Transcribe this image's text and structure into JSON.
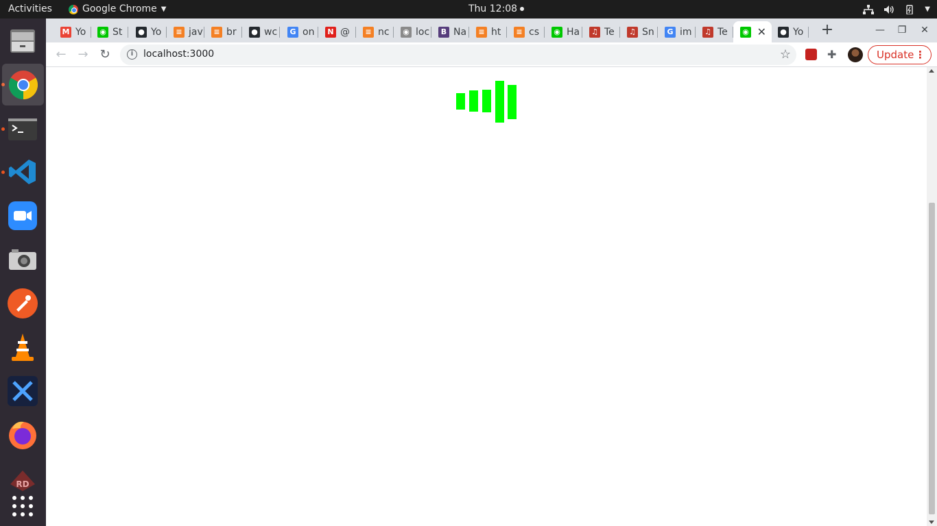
{
  "topbar": {
    "activities": "Activities",
    "app_name": "Google Chrome",
    "clock": "Thu 12:08"
  },
  "dock": {
    "items": [
      {
        "name": "files",
        "running": false
      },
      {
        "name": "google-chrome",
        "running": true,
        "active": true
      },
      {
        "name": "terminal",
        "running": true
      },
      {
        "name": "vscode",
        "running": true
      },
      {
        "name": "zoom",
        "running": false
      },
      {
        "name": "camera",
        "running": false
      },
      {
        "name": "postman",
        "running": false
      },
      {
        "name": "vlc",
        "running": false
      },
      {
        "name": "expressvpn",
        "running": false
      },
      {
        "name": "firefox",
        "running": false
      },
      {
        "name": "rd",
        "running": false
      },
      {
        "name": "show-applications",
        "running": false
      }
    ]
  },
  "tabs": [
    {
      "label": "Yo",
      "icon": "gmail-icon",
      "color": "#ea4335",
      "glyph": "M"
    },
    {
      "label": "St",
      "icon": "green-app-icon",
      "color": "#00c800",
      "glyph": "◉"
    },
    {
      "label": "Yo",
      "icon": "github-icon",
      "color": "#24292e",
      "glyph": "●"
    },
    {
      "label": "jav",
      "icon": "stackoverflow-icon",
      "color": "#f48024",
      "glyph": "≡"
    },
    {
      "label": "br",
      "icon": "stackoverflow-icon",
      "color": "#f48024",
      "glyph": "≡"
    },
    {
      "label": "wc",
      "icon": "github-icon",
      "color": "#24292e",
      "glyph": "●"
    },
    {
      "label": "on",
      "icon": "google-icon",
      "color": "#4285f4",
      "glyph": "G"
    },
    {
      "label": "@",
      "icon": "red-app-icon",
      "color": "#e0201b",
      "glyph": "N"
    },
    {
      "label": "nc",
      "icon": "stackoverflow-icon",
      "color": "#f48024",
      "glyph": "≡"
    },
    {
      "label": "loc",
      "icon": "gray-app-icon",
      "color": "#8a8a8a",
      "glyph": "◉"
    },
    {
      "label": "Na",
      "icon": "bootstrap-icon",
      "color": "#563d7c",
      "glyph": "B"
    },
    {
      "label": "ht",
      "icon": "stackoverflow-icon",
      "color": "#f48024",
      "glyph": "≡"
    },
    {
      "label": "cs",
      "icon": "stackoverflow-icon",
      "color": "#f48024",
      "glyph": "≡"
    },
    {
      "label": "Ha",
      "icon": "green-app-icon",
      "color": "#00c800",
      "glyph": "◉"
    },
    {
      "label": "Te",
      "icon": "music-icon",
      "color": "#c0392b",
      "glyph": "♫"
    },
    {
      "label": "Sn",
      "icon": "music-icon",
      "color": "#c0392b",
      "glyph": "♫"
    },
    {
      "label": "im",
      "icon": "google-icon",
      "color": "#4285f4",
      "glyph": "G"
    },
    {
      "label": "Te",
      "icon": "music-icon",
      "color": "#c0392b",
      "glyph": "♫"
    },
    {
      "label": "",
      "icon": "green-app-icon",
      "color": "#00c800",
      "glyph": "◉",
      "active": true
    },
    {
      "label": "Yo",
      "icon": "github-icon",
      "color": "#24292e",
      "glyph": "●"
    }
  ],
  "toolbar": {
    "url": "localhost:3000",
    "update_label": "Update"
  },
  "loader": {
    "color": "#00ff00"
  }
}
